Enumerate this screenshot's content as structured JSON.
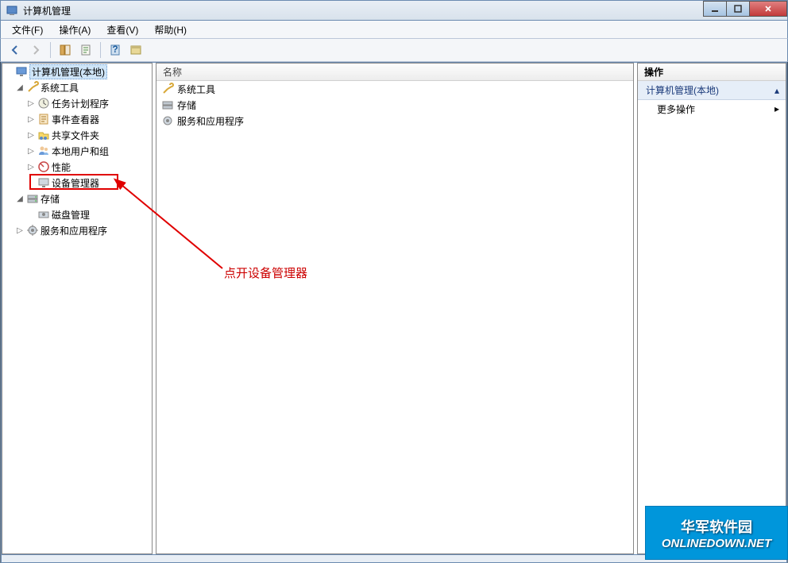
{
  "window": {
    "title": "计算机管理"
  },
  "menu": {
    "file": "文件(F)",
    "action": "操作(A)",
    "view": "查看(V)",
    "help": "帮助(H)"
  },
  "tree": {
    "root": "计算机管理(本地)",
    "system_tools": "系统工具",
    "task_scheduler": "任务计划程序",
    "event_viewer": "事件查看器",
    "shared_folders": "共享文件夹",
    "local_users": "本地用户和组",
    "performance": "性能",
    "device_manager": "设备管理器",
    "storage": "存储",
    "disk_management": "磁盘管理",
    "services_apps": "服务和应用程序"
  },
  "list": {
    "header": "名称",
    "items": [
      "系统工具",
      "存储",
      "服务和应用程序"
    ]
  },
  "actions": {
    "header": "操作",
    "section": "计算机管理(本地)",
    "more": "更多操作"
  },
  "annotation": {
    "text": "点开设备管理器"
  },
  "watermark": {
    "line1": "华军软件园",
    "line2": "ONLINEDOWN.NET"
  }
}
